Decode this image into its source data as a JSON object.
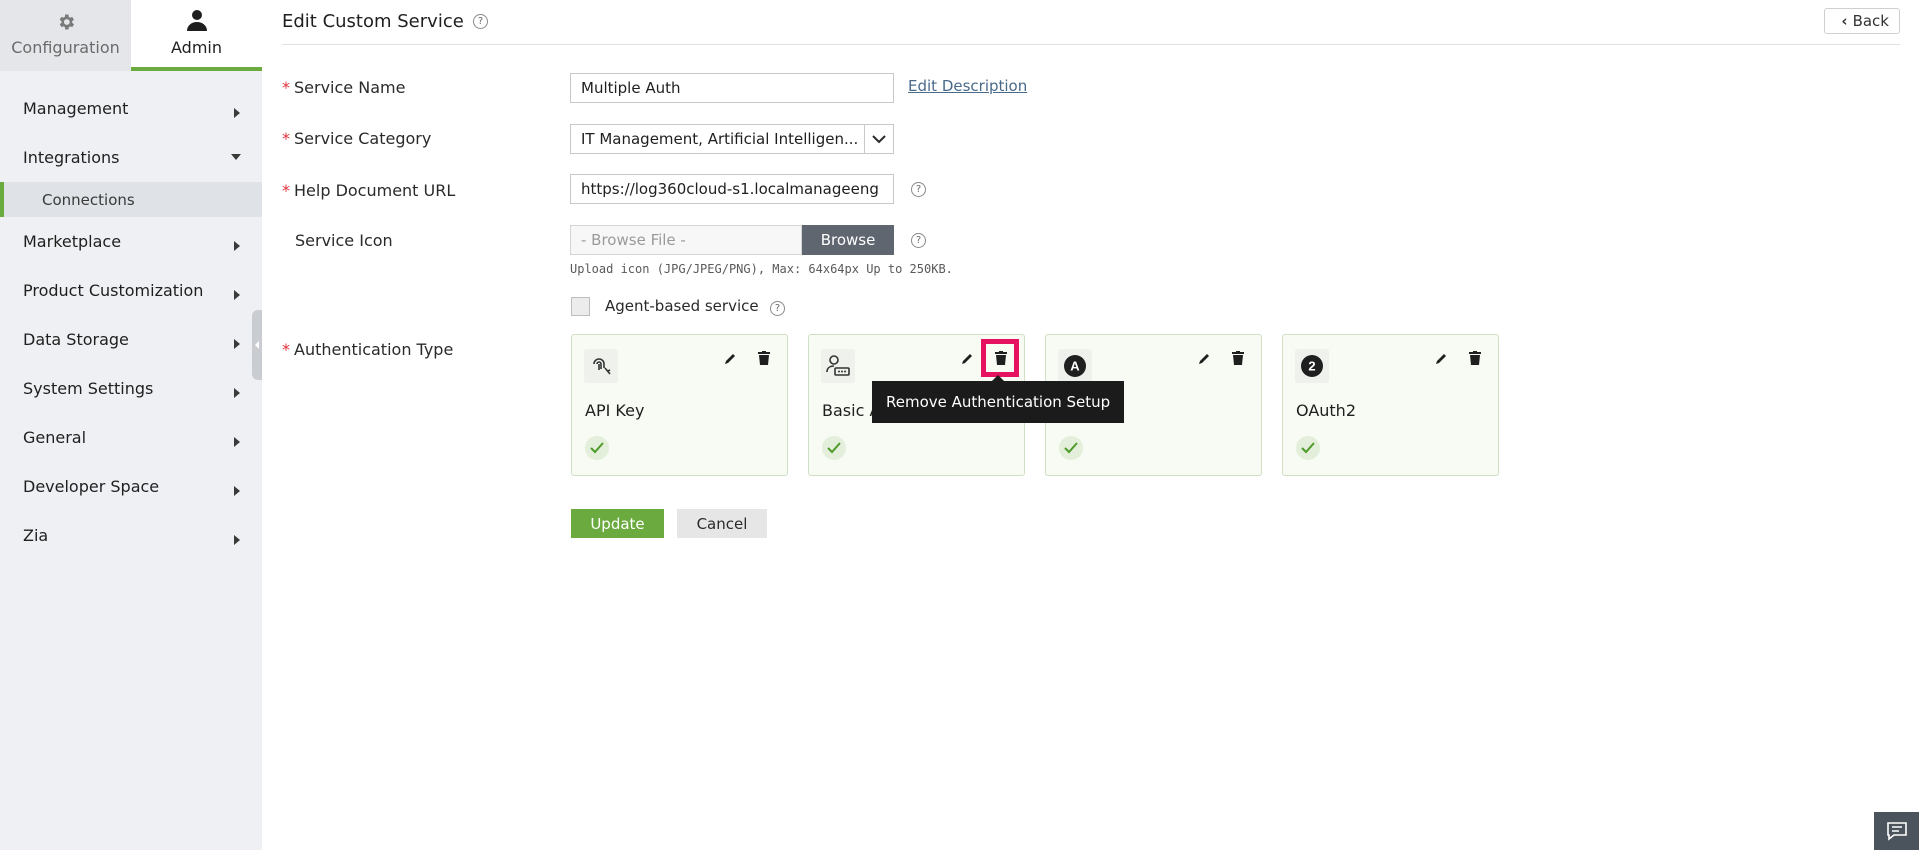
{
  "sidebar": {
    "tabs": [
      {
        "label": "Configuration",
        "icon": "gear-icon"
      },
      {
        "label": "Admin",
        "icon": "user-icon"
      }
    ],
    "items": [
      {
        "label": "Management"
      },
      {
        "label": "Integrations"
      },
      {
        "label": "Connections"
      },
      {
        "label": "Marketplace"
      },
      {
        "label": "Product Customization"
      },
      {
        "label": "Data Storage"
      },
      {
        "label": "System Settings"
      },
      {
        "label": "General"
      },
      {
        "label": "Developer Space"
      },
      {
        "label": "Zia"
      }
    ]
  },
  "header": {
    "title": "Edit Custom Service",
    "help": "?",
    "back_label": "Back"
  },
  "form": {
    "service_name": {
      "label": "Service Name",
      "value": "Multiple Auth",
      "link": "Edit Description"
    },
    "service_category": {
      "label": "Service Category",
      "value": "IT Management, Artificial Intelligen..."
    },
    "help_url": {
      "label": "Help Document URL",
      "value": "https://log360cloud-s1.localmanageeng"
    },
    "service_icon": {
      "label": "Service Icon",
      "placeholder": "- Browse File -",
      "browse": "Browse",
      "hint": "Upload icon (JPG/JPEG/PNG), Max: 64x64px Up to 250KB."
    },
    "agent_based": {
      "label": "Agent-based service"
    },
    "auth_type": {
      "label": "Authentication Type"
    },
    "required_mark": "*"
  },
  "auth_cards": [
    {
      "name": "API Key",
      "icon": "fingerprint-key-icon"
    },
    {
      "name": "Basic A",
      "icon": "user-password-icon"
    },
    {
      "name": "",
      "icon": "a-badge-icon"
    },
    {
      "name": "OAuth2",
      "icon": "oauth2-badge-icon"
    }
  ],
  "tooltip": "Remove Authentication Setup",
  "actions": {
    "update": "Update",
    "cancel": "Cancel"
  },
  "colors": {
    "accent": "#6aaa3f",
    "highlight": "#e5125f",
    "required": "#e0303a"
  }
}
